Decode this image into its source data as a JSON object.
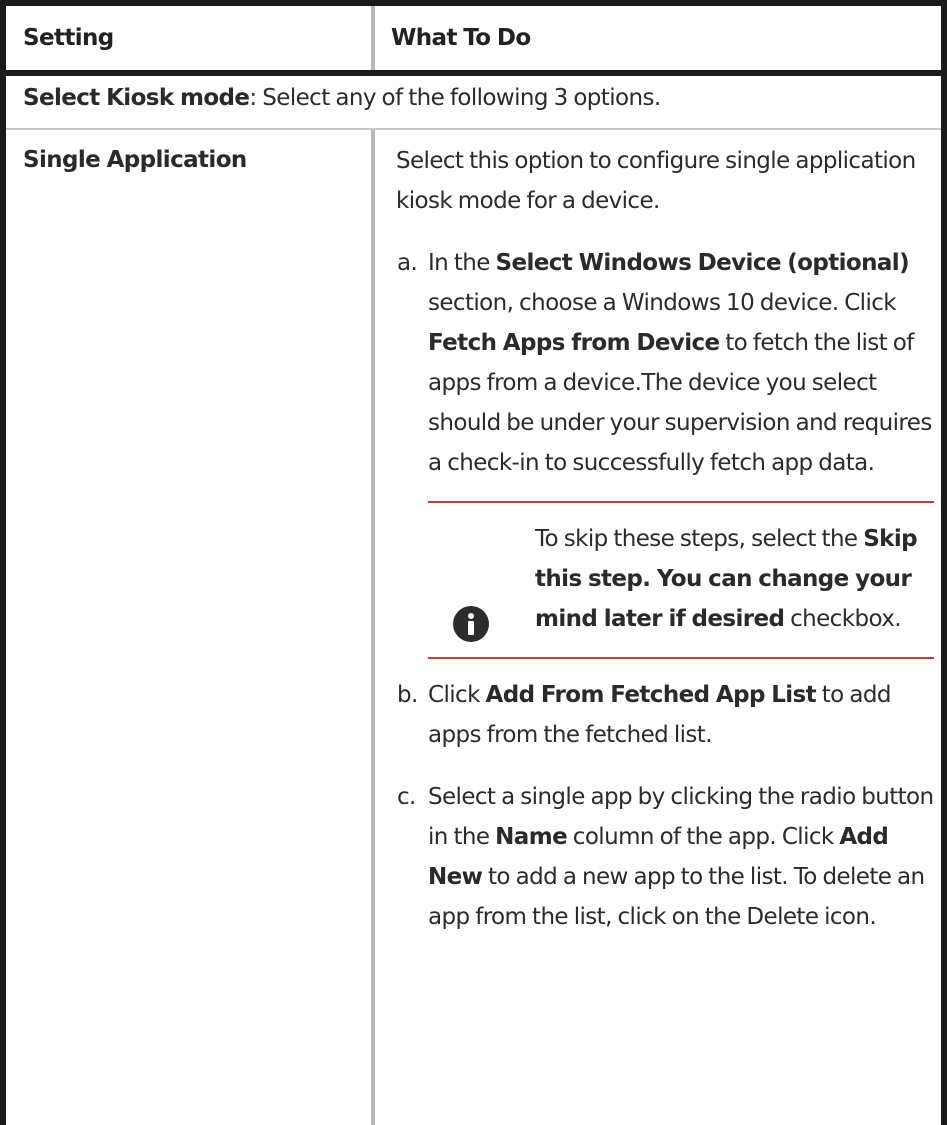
{
  "header": {
    "col1": "Setting",
    "col2": "What To Do"
  },
  "kiosk_mode": {
    "label": "Select Kiosk mode",
    "text": ": Select any of the following 3 options."
  },
  "single_application": {
    "label": "Single Application",
    "intro": "Select this option to configure single application kiosk mode for a device.",
    "steps": [
      {
        "marker": "a.",
        "parts": [
          "In the ",
          "Select Windows Device (optional)",
          " section, choose a Windows 10 device. Click ",
          "Fetch Apps from Device",
          " to fetch the list of apps from a device.The device you select should be under your supervision and requires a check-in to successfully fetch app data."
        ]
      },
      {
        "marker": "b.",
        "parts": [
          "Click ",
          "Add From Fetched App List",
          " to add apps from the fetched list."
        ]
      },
      {
        "marker": "c.",
        "parts": [
          "Select a single app by clicking the radio button in the ",
          "Name",
          " column of the app. Click ",
          "Add New",
          " to add a new app to the list. To delete an app from the list, click on the Delete icon."
        ]
      }
    ],
    "note": {
      "icon": "info-icon",
      "parts": [
        "To skip these steps, select the ",
        "Skip this step. You can change your mind later if desired",
        " checkbox."
      ]
    }
  },
  "colors": {
    "note_rule": "#c73b3b",
    "border": "#1a1a1a",
    "separator": "#b8b8b8"
  }
}
